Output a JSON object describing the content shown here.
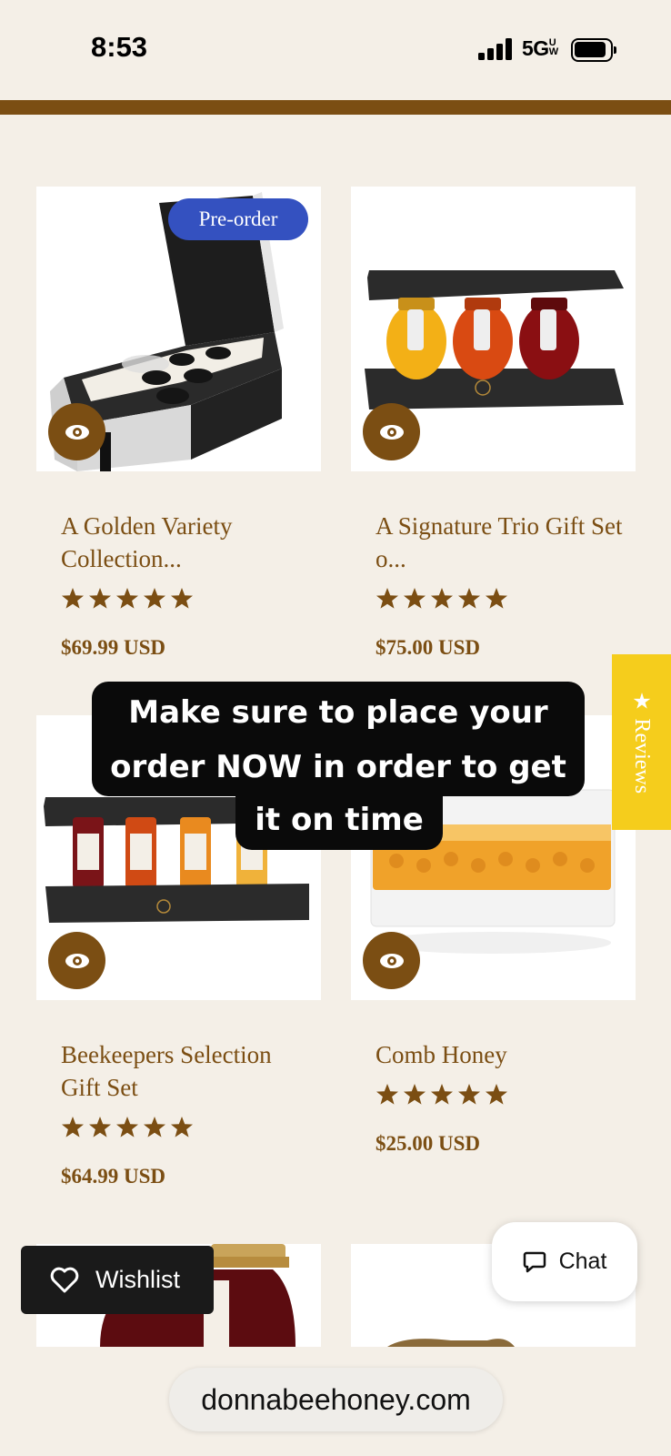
{
  "status_bar": {
    "time": "8:53",
    "network": "5G",
    "network_suffix": "UW"
  },
  "promo_banner": {
    "line1": "Make sure to place your",
    "line2": "order NOW in order to get",
    "line3": "it on time"
  },
  "products": [
    {
      "title": "A Golden Variety Collection...",
      "rating": 5,
      "price": "$69.99 USD",
      "badge": "Pre-order"
    },
    {
      "title": "A Signature Trio Gift Set o...",
      "rating": 5,
      "price": "$75.00 USD"
    },
    {
      "title": "Beekeepers Selection Gift Set",
      "rating": 5,
      "price": "$64.99 USD"
    },
    {
      "title": "Comb Honey",
      "rating": 5,
      "price": "$25.00 USD"
    }
  ],
  "reviews_tab": {
    "label": "Reviews",
    "icon": "star-icon"
  },
  "wishlist_button": {
    "label": "Wishlist",
    "icon": "heart-icon"
  },
  "chat_button": {
    "label": "Chat",
    "icon": "chat-bubble-icon"
  },
  "browser": {
    "url": "donnabeehoney.com"
  },
  "colors": {
    "brand_brown": "#7b4e13",
    "badge_blue": "#3451c0",
    "reviews_yellow": "#f5cd1c",
    "background": "#f4efe7"
  }
}
